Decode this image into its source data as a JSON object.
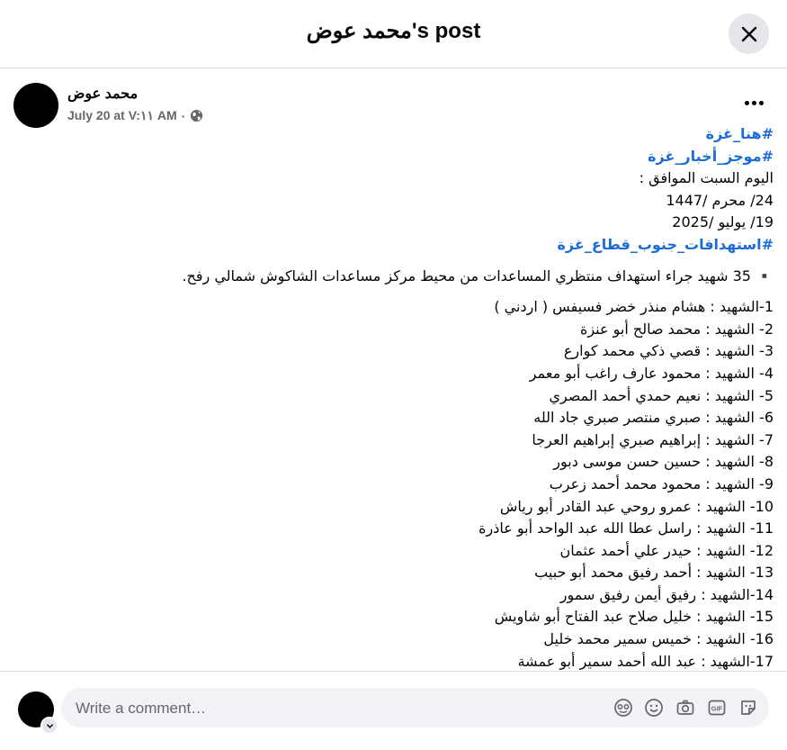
{
  "header": {
    "title": "محمد عوض's post"
  },
  "post": {
    "author": "محمد عوض",
    "timestamp": "July 20 at V:١١ AM",
    "separator": "·",
    "privacy_icon": "globe-icon",
    "lines": [
      {
        "text": "#هنا_غزة",
        "kind": "hashtag"
      },
      {
        "text": "#موجز_أخبار_غزة",
        "kind": "hashtag"
      },
      {
        "text": "اليوم السبت الموافق :",
        "kind": "text"
      },
      {
        "text": "24/ محرم /1447",
        "kind": "text"
      },
      {
        "text": "19/ يوليو /2025",
        "kind": "text"
      },
      {
        "text": "#استهدافات_جنوب_قطاع_غزة",
        "kind": "hashtag"
      },
      {
        "text": "",
        "kind": "gap"
      },
      {
        "text": "▪️ 35 شهيد جراء استهداف منتظري المساعدات  من محيط مركز مساعدات الشاكوش شمالي رفح.",
        "kind": "text"
      },
      {
        "text": "",
        "kind": "gap"
      },
      {
        "text": "1-الشهيد : هشام منذر خضر فسيفس ( اردني )",
        "kind": "text"
      },
      {
        "text": "2- الشهيد : محمد صالح أبو عنزة",
        "kind": "text"
      },
      {
        "text": "3- الشهيد : قصي  ذكي محمد كوارع",
        "kind": "text"
      },
      {
        "text": "4- الشهيد : محمود عارف راغب أبو معمر",
        "kind": "text"
      },
      {
        "text": "5- الشهيد : نعيم حمدي أحمد المصري",
        "kind": "text"
      },
      {
        "text": "6- الشهيد : صبري منتصر صبري جاد الله",
        "kind": "text"
      },
      {
        "text": "7- الشهيد : إبراهيم صبري إبراهيم العرجا",
        "kind": "text"
      },
      {
        "text": "8- الشهيد : حسين حسن موسى دبور",
        "kind": "text"
      },
      {
        "text": "9- الشهيد : محمود محمد أحمد زعرب",
        "kind": "text"
      },
      {
        "text": "10- الشهيد : عمرو روحي عبد القادر أبو رياش",
        "kind": "text"
      },
      {
        "text": "11- الشهيد : راسل عطا الله عبد الواحد أبو عاذرة",
        "kind": "text"
      },
      {
        "text": "12- الشهيد : حيدر علي أحمد عثمان",
        "kind": "text"
      },
      {
        "text": "13- الشهيد : أحمد رفيق محمد أبو حبيب",
        "kind": "text"
      },
      {
        "text": "14-الشهيد : رفيق أيمن رفيق سمور",
        "kind": "text"
      },
      {
        "text": "15- الشهيد : خليل صلاح عبد الفتاح أبو شاويش",
        "kind": "text"
      },
      {
        "text": "16- الشهيد : خميس سمير محمد خليل",
        "kind": "text"
      },
      {
        "text": "17-الشهيد : عبد الله أحمد سمير أبو عمشة",
        "kind": "text"
      }
    ]
  },
  "composer": {
    "placeholder": "Write a comment…",
    "icons": [
      "avatar-sticker-icon",
      "emoji-icon",
      "camera-icon",
      "gif-icon",
      "sticker-icon"
    ]
  }
}
